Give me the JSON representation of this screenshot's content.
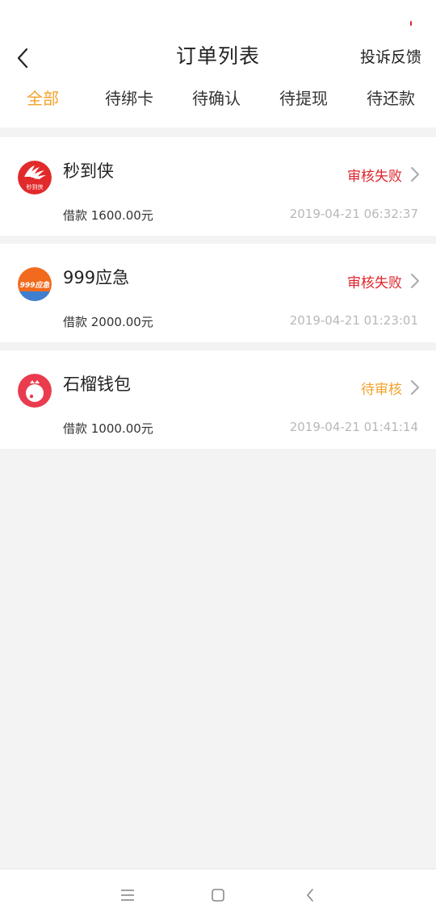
{
  "header": {
    "title": "订单列表",
    "feedback_label": "投诉反馈"
  },
  "tabs": [
    {
      "label": "全部",
      "active": true
    },
    {
      "label": "待绑卡",
      "active": false
    },
    {
      "label": "待确认",
      "active": false
    },
    {
      "label": "待提现",
      "active": false
    },
    {
      "label": "待还款",
      "active": false
    }
  ],
  "orders": [
    {
      "name": "秒到侠",
      "logo_text": "秒到侠",
      "status": "审核失败",
      "status_color": "#e0232b",
      "loan_text": "借款 1600.00元",
      "time": "2019-04-21 06:32:37"
    },
    {
      "name": "999应急",
      "logo_text": "999应急",
      "status": "审核失败",
      "status_color": "#e0232b",
      "loan_text": "借款 2000.00元",
      "time": "2019-04-21 01:23:01"
    },
    {
      "name": "石榴钱包",
      "status": "待审核",
      "status_color": "#f2a22b",
      "loan_text": "借款 1000.00元",
      "time": "2019-04-21 01:41:14"
    }
  ],
  "colors": {
    "accent": "#f2a22b",
    "fail": "#e0232b",
    "background": "#f3f3f3"
  },
  "icons": [
    "back-arrow-icon",
    "chevron-right-icon",
    "menu-icon",
    "home-square-icon",
    "nav-back-icon"
  ]
}
